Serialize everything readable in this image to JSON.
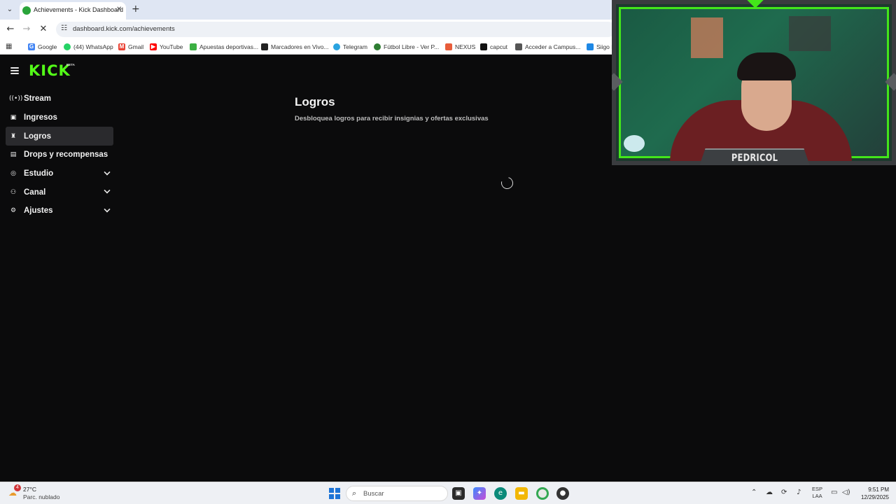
{
  "browser": {
    "tab": {
      "title": "Achievements - Kick Dashboard",
      "close": "✕"
    },
    "new_tab": "+",
    "url": "dashboard.kick.com/achievements",
    "bookmarks": [
      {
        "label": "Google",
        "icon": "google-icon",
        "color": "#4285f4"
      },
      {
        "label": "(44) WhatsApp",
        "icon": "whatsapp-icon",
        "color": "#25d366"
      },
      {
        "label": "Gmail",
        "icon": "gmail-icon",
        "color": "#ea4335"
      },
      {
        "label": "YouTube",
        "icon": "youtube-icon",
        "color": "#ff0000"
      },
      {
        "label": "Apuestas deportivas...",
        "icon": "betting-icon",
        "color": "#3cb043"
      },
      {
        "label": "Marcadores en Vivo...",
        "icon": "scores-icon",
        "color": "#222222"
      },
      {
        "label": "Telegram",
        "icon": "telegram-icon",
        "color": "#2aa3e0"
      },
      {
        "label": "Fútbol Libre - Ver P...",
        "icon": "football-icon",
        "color": "#2e7d32"
      },
      {
        "label": "NEXUS",
        "icon": "nexus-icon",
        "color": "#e85d3a"
      },
      {
        "label": "capcut",
        "icon": "capcut-icon",
        "color": "#111111"
      },
      {
        "label": "Acceder a Campus...",
        "icon": "campus-icon",
        "color": "#555555"
      },
      {
        "label": "Siigo F",
        "icon": "siigo-icon",
        "color": "#1e88e5"
      }
    ]
  },
  "app": {
    "logo": "KICK",
    "logo_tag": "BETA",
    "accent": "#53fc18",
    "sidebar": [
      {
        "label": "Stream",
        "icon": "broadcast-icon",
        "glyph": "((•))",
        "active": false,
        "expandable": false
      },
      {
        "label": "Ingresos",
        "icon": "revenue-icon",
        "glyph": "▣",
        "active": false,
        "expandable": false
      },
      {
        "label": "Logros",
        "icon": "trophy-icon",
        "glyph": "🏆",
        "active": true,
        "expandable": false
      },
      {
        "label": "Drops y recompensas",
        "icon": "drops-icon",
        "glyph": "▤",
        "active": false,
        "expandable": false
      },
      {
        "label": "Estudio",
        "icon": "studio-icon",
        "glyph": "◎",
        "active": false,
        "expandable": true
      },
      {
        "label": "Canal",
        "icon": "channel-icon",
        "glyph": "⚇",
        "active": false,
        "expandable": true
      },
      {
        "label": "Ajustes",
        "icon": "settings-icon",
        "glyph": "⚙",
        "active": false,
        "expandable": true
      }
    ],
    "main": {
      "title": "Logros",
      "subtitle": "Desbloquea logros para recibir insignias y ofertas exclusivas"
    }
  },
  "webcam": {
    "name": "PEDRICOL",
    "frame_color": "#43e61a"
  },
  "taskbar": {
    "weather_badge": "4",
    "temperature": "27°C",
    "condition": "Parc. nublado",
    "search_placeholder": "Buscar",
    "lang_top": "ESP",
    "lang_bottom": "LAA",
    "time": "9:51 PM",
    "date": "12/29/2025"
  }
}
